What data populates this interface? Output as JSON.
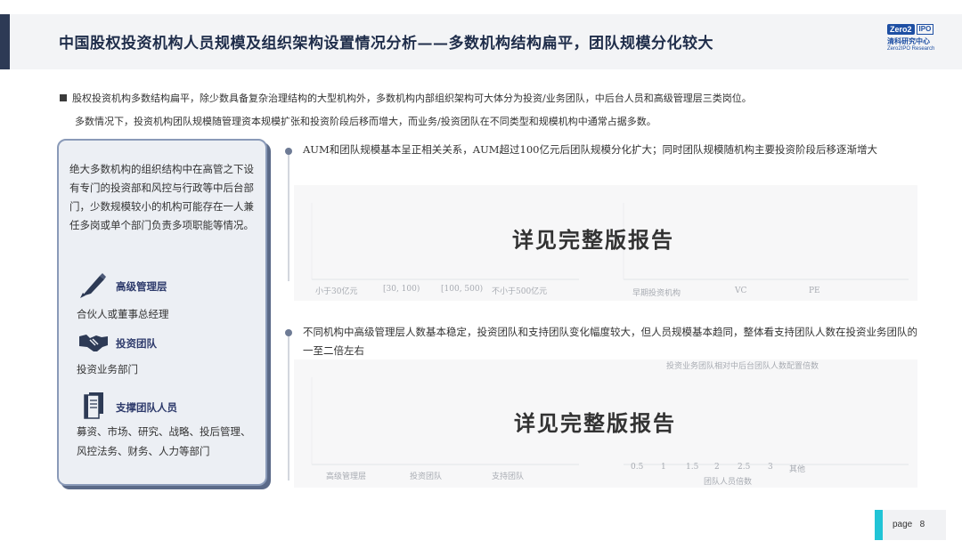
{
  "header": {
    "title": "中国股权投资机构人员规模及组织架构设置情况分析——多数机构结构扁平，团队规模分化较大",
    "logo": {
      "box1": "Zero2",
      "box2": "IPO",
      "cn": "清科研究中心",
      "en": "Zero2IPO Research"
    }
  },
  "bullet": {
    "line1": "股权投资机构多数结构扁平，除少数具备复杂治理结构的大型机构外，多数机构内部组织架构可大体分为投资/业务团队，中后台人员和高级管理层三类岗位。",
    "line2": "多数情况下，投资机构团队规模随管理资本规模扩张和投资阶段后移而增大，而业务/投资团队在不同类型和规模机构中通常占据多数。"
  },
  "left_card": {
    "intro": "绝大多数机构的组织结构中在高管之下设有专门的投资部和风控与行政等中后台部门，少数规模较小的机构可能存在一人兼任多岗或单个部门负责多项职能等情况。",
    "categories": [
      {
        "icon": "pen-icon",
        "label": "高级管理层",
        "desc": "合伙人或董事总经理"
      },
      {
        "icon": "handshake-icon",
        "label": "投资团队",
        "desc": "投资业务部门"
      },
      {
        "icon": "documents-icon",
        "label": "支撑团队人员",
        "desc": "募资、市场、研究、战略、投后管理、风控法务、财务、人力等部门"
      }
    ]
  },
  "section1": {
    "text": "AUM和团队规模基本呈正相关关系，AUM超过100亿元后团队规模分化扩大；同时团队规模随机构主要投资阶段后移逐渐增大",
    "overlay": "详见完整版报告",
    "faint_labels": [
      "小于30亿元",
      "[30, 100)",
      "[100, 500)",
      "不小于500亿元",
      "早期投资机构",
      "VC",
      "PE"
    ]
  },
  "section2": {
    "text": "不同机构中高级管理层人数基本稳定，投资团队和支持团队变化幅度较大，但人员规模基本趋同，整体看支持团队人数在投资业务团队的一至二倍左右",
    "overlay": "详见完整版报告",
    "faint_labels": [
      "高级管理层",
      "投资团队",
      "支持团队",
      "0.5",
      "1",
      "1.5",
      "2",
      "2.5",
      "3",
      "其他",
      "团队人员倍数",
      "投资业务团队相对中后台团队人数配置倍数"
    ]
  },
  "footer": {
    "page_label": "page",
    "page_number": "8"
  },
  "colors": {
    "navy": "#2d3a55",
    "accent_cyan": "#21c4d6",
    "card_border": "#8a9ab8"
  }
}
